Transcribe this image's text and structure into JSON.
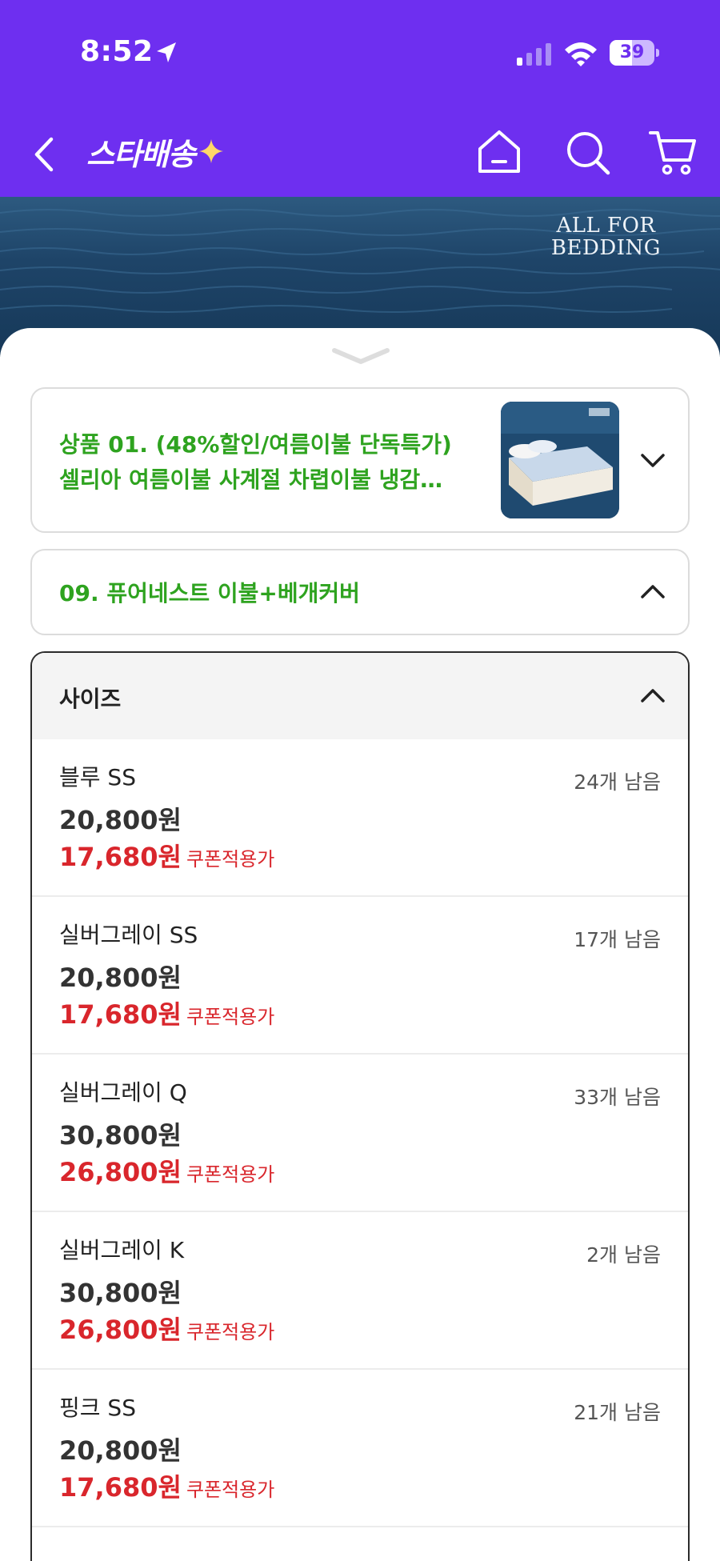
{
  "status_bar": {
    "time": "8:52",
    "battery": "39"
  },
  "header": {
    "logo": "스타배송"
  },
  "hero": {
    "brand_line1": "ALL FOR",
    "brand_line2": "BEDDING"
  },
  "product": {
    "title_line1": "상품 01. (48%할인/여름이불 단독특가)",
    "title_line2": "셀리아 여름이불 사계절 차렵이불 냉감…"
  },
  "option": {
    "title": "09. 퓨어네스트 이불+베개커버"
  },
  "size_section": {
    "label": "사이즈",
    "coupon_label": "쿠폰적용가",
    "items": [
      {
        "name": "블루 SS",
        "stock": "24개 남음",
        "price": "20,800원",
        "coupon_price": "17,680원"
      },
      {
        "name": "실버그레이 SS",
        "stock": "17개 남음",
        "price": "20,800원",
        "coupon_price": "17,680원"
      },
      {
        "name": "실버그레이 Q",
        "stock": "33개 남음",
        "price": "30,800원",
        "coupon_price": "26,800원"
      },
      {
        "name": "실버그레이 K",
        "stock": "2개 남음",
        "price": "30,800원",
        "coupon_price": "26,800원"
      },
      {
        "name": "핑크 SS",
        "stock": "21개 남음",
        "price": "20,800원",
        "coupon_price": "17,680원"
      }
    ]
  },
  "colors": {
    "header_purple": "#6e2ff0",
    "option_green": "#2ea31f",
    "coupon_red": "#d9262c"
  },
  "icons": [
    "location-arrow-icon",
    "cellular-signal-icon",
    "wifi-icon",
    "battery-icon",
    "back-icon",
    "sparkle-icon",
    "home-icon",
    "search-icon",
    "cart-icon",
    "sheet-handle-icon",
    "chevron-down-icon",
    "chevron-up-icon"
  ]
}
